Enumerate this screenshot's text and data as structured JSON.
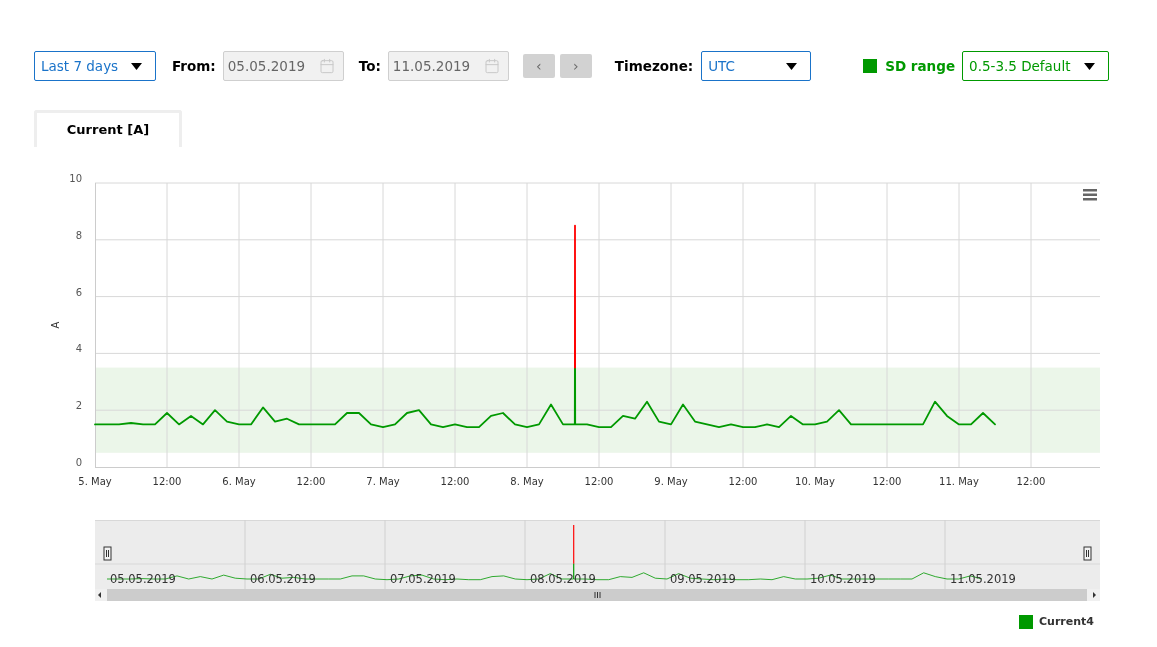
{
  "controls": {
    "period": {
      "value": "Last 7 days"
    },
    "from": {
      "label": "From:",
      "value": "05.05.2019"
    },
    "to": {
      "label": "To:",
      "value": "11.05.2019"
    },
    "prev_button": {
      "label": "‹",
      "disabled": true
    },
    "next_button": {
      "label": "›",
      "disabled": true
    },
    "timezone": {
      "label": "Timezone:",
      "value": "UTC"
    },
    "sd_range": {
      "label": "SD range",
      "color": "#009900",
      "value": "0.5-3.5 Default"
    }
  },
  "tabs": [
    {
      "label": "Current [A]",
      "selected": true
    }
  ],
  "chart": {
    "chart_data": {
      "type": "line",
      "ylabel": "A",
      "x": [
        "2019-05-05T00:00",
        "2019-05-05T02:00",
        "2019-05-05T04:00",
        "2019-05-05T06:00",
        "2019-05-05T08:00",
        "2019-05-05T10:00",
        "2019-05-05T12:00",
        "2019-05-05T14:00",
        "2019-05-05T16:00",
        "2019-05-05T18:00",
        "2019-05-05T20:00",
        "2019-05-05T22:00",
        "2019-05-06T00:00",
        "2019-05-06T02:00",
        "2019-05-06T04:00",
        "2019-05-06T06:00",
        "2019-05-06T08:00",
        "2019-05-06T10:00",
        "2019-05-06T12:00",
        "2019-05-06T14:00",
        "2019-05-06T16:00",
        "2019-05-06T18:00",
        "2019-05-06T20:00",
        "2019-05-06T22:00",
        "2019-05-07T00:00",
        "2019-05-07T02:00",
        "2019-05-07T04:00",
        "2019-05-07T06:00",
        "2019-05-07T08:00",
        "2019-05-07T10:00",
        "2019-05-07T12:00",
        "2019-05-07T14:00",
        "2019-05-07T16:00",
        "2019-05-07T18:00",
        "2019-05-07T20:00",
        "2019-05-07T22:00",
        "2019-05-08T00:00",
        "2019-05-08T02:00",
        "2019-05-08T04:00",
        "2019-05-08T06:00",
        "2019-05-08T07:58",
        "2019-05-08T07:59",
        "2019-05-08T08:00",
        "2019-05-08T08:01",
        "2019-05-08T08:02",
        "2019-05-08T10:00",
        "2019-05-08T12:00",
        "2019-05-08T14:00",
        "2019-05-08T16:00",
        "2019-05-08T18:00",
        "2019-05-08T20:00",
        "2019-05-08T22:00",
        "2019-05-09T00:00",
        "2019-05-09T02:00",
        "2019-05-09T04:00",
        "2019-05-09T06:00",
        "2019-05-09T08:00",
        "2019-05-09T10:00",
        "2019-05-09T12:00",
        "2019-05-09T14:00",
        "2019-05-09T16:00",
        "2019-05-09T18:00",
        "2019-05-09T20:00",
        "2019-05-09T22:00",
        "2019-05-10T00:00",
        "2019-05-10T02:00",
        "2019-05-10T04:00",
        "2019-05-10T06:00",
        "2019-05-10T08:00",
        "2019-05-10T10:00",
        "2019-05-10T12:00",
        "2019-05-10T14:00",
        "2019-05-10T16:00",
        "2019-05-10T18:00",
        "2019-05-10T20:00",
        "2019-05-10T22:00",
        "2019-05-11T00:00",
        "2019-05-11T02:00",
        "2019-05-11T04:00",
        "2019-05-11T06:00"
      ],
      "series": [
        {
          "name": "Current4",
          "color": "#009900",
          "values": [
            1.5,
            1.5,
            1.5,
            1.55,
            1.5,
            1.5,
            1.9,
            1.5,
            1.8,
            1.5,
            2.0,
            1.6,
            1.5,
            1.5,
            2.1,
            1.6,
            1.7,
            1.5,
            1.5,
            1.5,
            1.5,
            1.9,
            1.9,
            1.5,
            1.4,
            1.5,
            1.9,
            2.0,
            1.5,
            1.4,
            1.5,
            1.4,
            1.4,
            1.8,
            1.9,
            1.5,
            1.4,
            1.5,
            2.2,
            1.5,
            1.5,
            3.5,
            null,
            3.5,
            1.5,
            1.5,
            1.4,
            1.4,
            1.8,
            1.7,
            2.3,
            1.6,
            1.5,
            2.2,
            1.6,
            1.5,
            1.4,
            1.5,
            1.4,
            1.4,
            1.5,
            1.4,
            1.8,
            1.5,
            1.5,
            1.6,
            2.0,
            1.5,
            1.5,
            1.5,
            1.5,
            1.5,
            1.5,
            1.5,
            2.3,
            1.8,
            1.5,
            1.5,
            1.9,
            1.5
          ]
        },
        {
          "color": "#ff0000",
          "values": [
            null,
            null,
            null,
            null,
            null,
            null,
            null,
            null,
            null,
            null,
            null,
            null,
            null,
            null,
            null,
            null,
            null,
            null,
            null,
            null,
            null,
            null,
            null,
            null,
            null,
            null,
            null,
            null,
            null,
            null,
            null,
            null,
            null,
            null,
            null,
            null,
            null,
            null,
            null,
            null,
            null,
            3.5,
            8.5,
            3.5,
            null,
            null,
            null,
            null,
            null,
            null,
            null,
            null,
            null,
            null,
            null,
            null,
            null,
            null,
            null,
            null,
            null,
            null,
            null,
            null,
            null,
            null,
            null,
            null,
            null,
            null,
            null,
            null,
            null,
            null,
            null,
            null,
            null,
            null,
            null,
            null
          ]
        }
      ],
      "xlim": [
        "2019-05-05T00:00",
        "2019-05-11T23:30"
      ],
      "ylim": [
        0,
        10
      ],
      "yticks": [
        0,
        2,
        4,
        6,
        8,
        10
      ],
      "xticks": [
        {
          "value": "2019-05-05T00:00",
          "label": "5. May"
        },
        {
          "value": "2019-05-05T12:00",
          "label": "12:00"
        },
        {
          "value": "2019-05-06T00:00",
          "label": "6. May"
        },
        {
          "value": "2019-05-06T12:00",
          "label": "12:00"
        },
        {
          "value": "2019-05-07T00:00",
          "label": "7. May"
        },
        {
          "value": "2019-05-07T12:00",
          "label": "12:00"
        },
        {
          "value": "2019-05-08T00:00",
          "label": "8. May"
        },
        {
          "value": "2019-05-08T12:00",
          "label": "12:00"
        },
        {
          "value": "2019-05-09T00:00",
          "label": "9. May"
        },
        {
          "value": "2019-05-09T12:00",
          "label": "12:00"
        },
        {
          "value": "2019-05-10T00:00",
          "label": "10. May"
        },
        {
          "value": "2019-05-10T12:00",
          "label": "12:00"
        },
        {
          "value": "2019-05-11T00:00",
          "label": "11. May"
        },
        {
          "value": "2019-05-11T12:00",
          "label": "12:00"
        }
      ],
      "bands": [
        {
          "axis": "y",
          "from": 0.5,
          "to": 3.5,
          "color": "#ebf6e9"
        }
      ],
      "grid": true
    }
  },
  "navigator": {
    "labels": [
      "05.05.2019",
      "06.05.2019",
      "07.05.2019",
      "08.05.2019",
      "09.05.2019",
      "10.05.2019",
      "11.05.2019"
    ]
  }
}
